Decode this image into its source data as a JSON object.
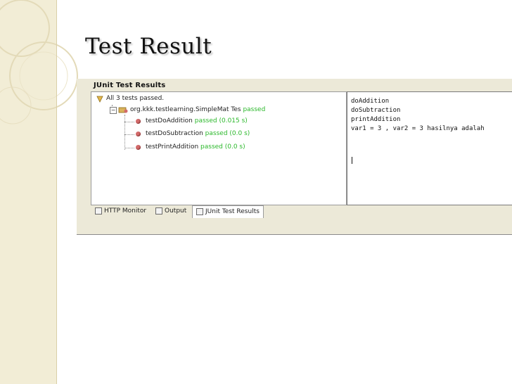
{
  "slide": {
    "title": "Test Result"
  },
  "window": {
    "title": "JUnit Test Results"
  },
  "tree": {
    "summary": "All 3 tests passed.",
    "suite": {
      "name": "org.kkk.testlearning.SimpleMat Tes",
      "status": "passed"
    },
    "tests": [
      {
        "name": "testDoAddition",
        "status": "passed (0.015 s)"
      },
      {
        "name": "testDoSubtraction",
        "status": "passed (0.0 s)"
      },
      {
        "name": "testPrintAddition",
        "status": "passed (0.0 s)"
      }
    ]
  },
  "output": {
    "lines": [
      "doAddition",
      "doSubtraction",
      "printAddition",
      "var1 = 3 , var2 = 3 hasilnya adalah"
    ]
  },
  "tabs": [
    {
      "label": "HTTP Monitor",
      "icon": "monitor-icon"
    },
    {
      "label": "Output",
      "icon": "output-icon"
    },
    {
      "label": "JUnit Test Results",
      "icon": "junit-icon"
    }
  ],
  "colors": {
    "passed": "#2bb82b",
    "panel": "#ece9d8",
    "slide_deco": "#f2edd6"
  }
}
